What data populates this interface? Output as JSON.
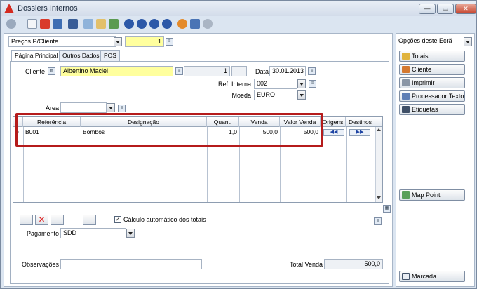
{
  "window": {
    "title": "Dossiers Internos"
  },
  "colors": {
    "accent": "#b51b1b",
    "required_field": "#ffff9e"
  },
  "header": {
    "doc_type": "Preços P/Cliente",
    "doc_number": "1"
  },
  "tabs": [
    "Página Principal",
    "Outros Dados",
    "POS"
  ],
  "form": {
    "cliente_label": "Cliente",
    "cliente_value": "Albertino Maciel",
    "cliente_num": "1",
    "data_label": "Data",
    "data_value": "30.01.2013",
    "ref_label": "Ref. Interna",
    "ref_value": "002",
    "moeda_label": "Moeda",
    "moeda_value": "EURO",
    "area_label": "Área",
    "area_value": ""
  },
  "grid": {
    "columns": [
      "Referência",
      "Designação",
      "Quant.",
      "Venda",
      "Valor Venda",
      "Origens",
      "Destinos"
    ],
    "rows": [
      {
        "ref": "B001",
        "designacao": "Bombos",
        "quant": "1,0",
        "venda": "500,0",
        "valor_venda": "500,0"
      }
    ]
  },
  "bottom": {
    "auto_calc_label": "Cálculo automático dos totais",
    "pagamento_label": "Pagamento",
    "pagamento_value": "SDD",
    "observacoes_label": "Observações",
    "total_venda_label": "Total Venda",
    "total_venda_value": "500,0"
  },
  "side": {
    "options_label": "Opções deste Ecrã",
    "buttons": [
      "Totais",
      "Cliente",
      "Imprimir",
      "Processador Texto",
      "Etiquetas"
    ],
    "map_point": "Map Point",
    "marcada": "Marcada"
  }
}
